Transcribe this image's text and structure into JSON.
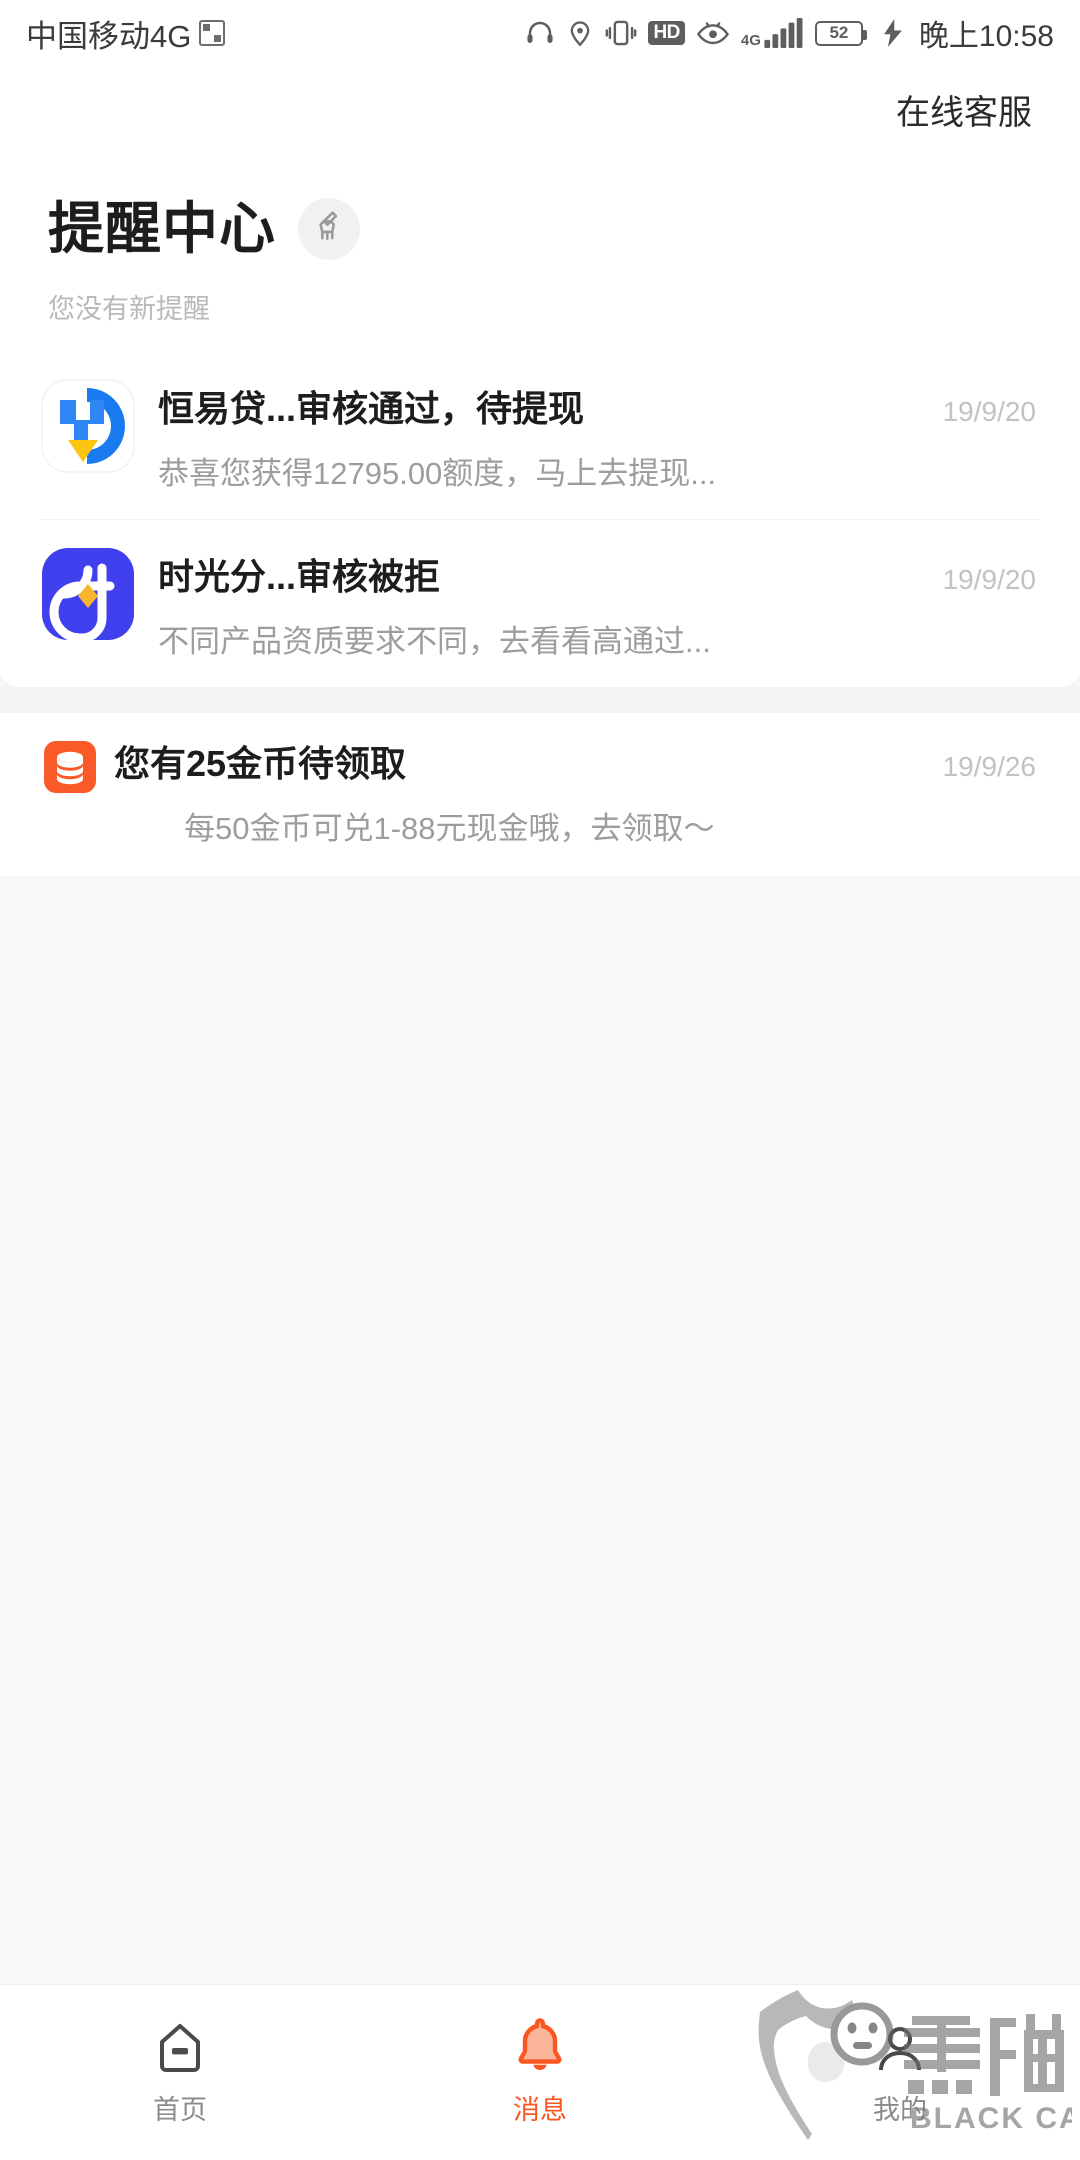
{
  "statusbar": {
    "carrier": "中国移动4G",
    "qr_icon": "qr-code-icon",
    "icons": [
      "headset-icon",
      "location-icon",
      "vibrate-icon",
      "hd-icon",
      "eye-care-icon",
      "signal-4g-icon"
    ],
    "hd_label": "HD",
    "network_label": "4G",
    "battery_level": "52",
    "time": "晚上10:58"
  },
  "topbar": {
    "customer_service": "在线客服"
  },
  "header": {
    "title": "提醒中心",
    "clear_icon": "broom-icon",
    "subtitle": "您没有新提醒"
  },
  "notifications": [
    {
      "icon": "hengyidai-app-icon",
      "title": "恒易贷...审核通过，待提现",
      "desc": "恭喜您获得12795.00额度，马上去提现...",
      "date": "19/9/20"
    },
    {
      "icon": "shiguangfen-app-icon",
      "title": "时光分...审核被拒",
      "desc": "不同产品资质要求不同，去看看高通过...",
      "date": "19/9/20"
    }
  ],
  "coin_notice": {
    "icon": "coin-stack-icon",
    "title": "您有25金币待领取",
    "desc": "每50金币可兑1-88元现金哦，去领取～",
    "date": "19/9/26"
  },
  "bottomnav": {
    "items": [
      {
        "icon": "home-icon",
        "label": "首页",
        "active": false
      },
      {
        "icon": "bell-icon",
        "label": "消息",
        "active": true
      },
      {
        "icon": "user-icon",
        "label": "我的",
        "active": false
      }
    ]
  },
  "watermark": {
    "logo": "black-cat-logo",
    "cn_text": "黑猫",
    "en_text": "BLACK CAT"
  },
  "colors": {
    "accent": "#fb5522",
    "background": "#f7f8f8",
    "card": "#ffffff",
    "title_text": "#1d1d1d",
    "muted_text": "#9d9d9d",
    "date_text": "#c2c2c2"
  }
}
